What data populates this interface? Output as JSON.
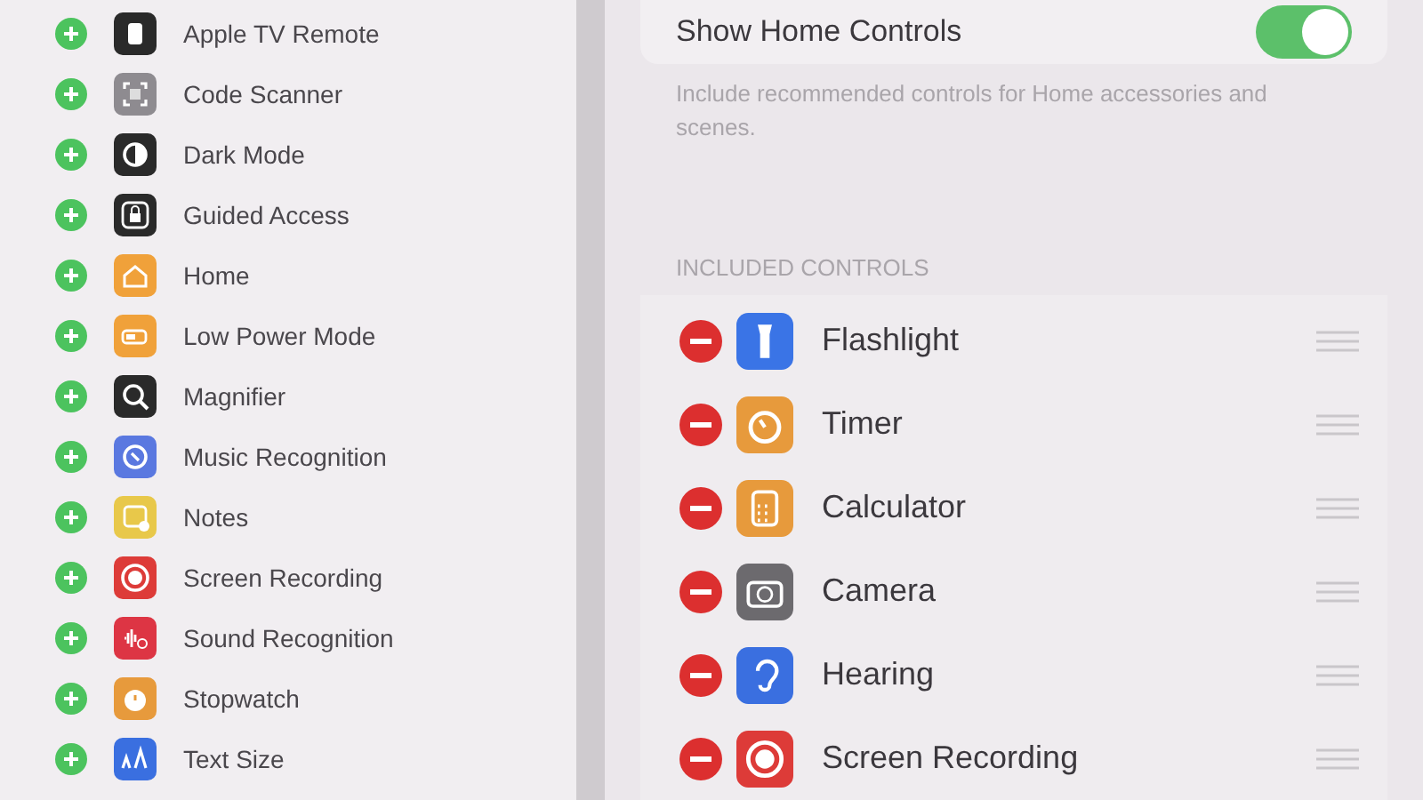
{
  "available_controls": [
    {
      "label": "Apple TV Remote"
    },
    {
      "label": "Code Scanner"
    },
    {
      "label": "Dark Mode"
    },
    {
      "label": "Guided Access"
    },
    {
      "label": "Home"
    },
    {
      "label": "Low Power Mode"
    },
    {
      "label": "Magnifier"
    },
    {
      "label": "Music Recognition"
    },
    {
      "label": "Notes"
    },
    {
      "label": "Screen Recording"
    },
    {
      "label": "Sound Recognition"
    },
    {
      "label": "Stopwatch"
    },
    {
      "label": "Text Size"
    }
  ],
  "home_controls": {
    "label": "Show Home Controls",
    "on": true,
    "footer": "Include recommended controls for Home accessories and scenes."
  },
  "included_header": "INCLUDED CONTROLS",
  "included_controls": [
    {
      "label": "Flashlight"
    },
    {
      "label": "Timer"
    },
    {
      "label": "Calculator"
    },
    {
      "label": "Camera"
    },
    {
      "label": "Hearing"
    },
    {
      "label": "Screen Recording"
    }
  ]
}
